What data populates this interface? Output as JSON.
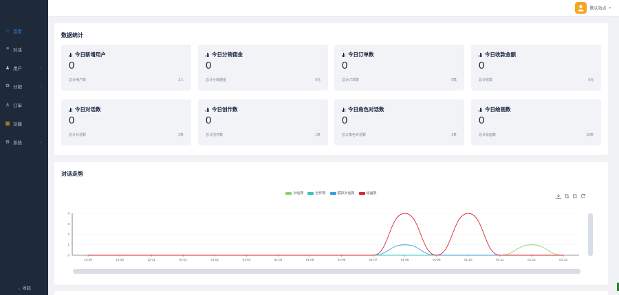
{
  "sidebar": {
    "items": [
      {
        "label": "首页",
        "icon": "home-icon",
        "active": true,
        "expandable": false
      },
      {
        "label": "对话",
        "icon": "menu-icon",
        "active": false,
        "expandable": false
      },
      {
        "label": "用户",
        "icon": "user-icon",
        "active": false,
        "expandable": true
      },
      {
        "label": "分销",
        "icon": "share-icon",
        "active": false,
        "expandable": true
      },
      {
        "label": "订单",
        "icon": "order-icon",
        "active": false,
        "expandable": false
      },
      {
        "label": "功能",
        "icon": "apps-icon",
        "active": false,
        "expandable": false
      },
      {
        "label": "系统",
        "icon": "gear-icon",
        "active": false,
        "expandable": true
      }
    ],
    "collapse_label": "← 收起"
  },
  "header": {
    "user_name": "默认站点",
    "caret": "▾"
  },
  "stats": {
    "title": "数据统计",
    "cards": [
      {
        "title": "今日新增用户",
        "value": "0",
        "foot_label": "总计用户数",
        "foot_value": "2人"
      },
      {
        "title": "今日分销佣金",
        "value": "0",
        "foot_label": "总计分销佣金",
        "foot_value": "0元"
      },
      {
        "title": "今日订单数",
        "value": "0",
        "foot_label": "总计订单数",
        "foot_value": "0笔"
      },
      {
        "title": "今日收款金额",
        "value": "0",
        "foot_label": "总计收款",
        "foot_value": "0元"
      },
      {
        "title": "今日对话数",
        "value": "0",
        "foot_label": "总计对话数",
        "foot_value": "2条"
      },
      {
        "title": "今日创作数",
        "value": "0",
        "foot_label": "总计创作数",
        "foot_value": "1条"
      },
      {
        "title": "今日角色对话数",
        "value": "0",
        "foot_label": "总计角色对话数",
        "foot_value": "1条"
      },
      {
        "title": "今日绘画数",
        "value": "0",
        "foot_label": "总计绘画数",
        "foot_value": "10条"
      }
    ]
  },
  "trend": {
    "title": "对话走势",
    "toolbox": [
      "download-icon",
      "zoom-icon",
      "zoom-reset-icon",
      "refresh-icon"
    ]
  },
  "chart_data": {
    "type": "line",
    "x": [
      "12-29",
      "12-30",
      "12-31",
      "01-01",
      "01-02",
      "01-03",
      "01-04",
      "01-05",
      "01-06",
      "01-07",
      "01-08",
      "01-09",
      "01-10",
      "01-11",
      "01-12",
      "01-13"
    ],
    "ylim": [
      0,
      4
    ],
    "yticks": [
      0,
      1,
      2,
      3,
      4
    ],
    "smooth": true,
    "legend_position": "top-center",
    "series": [
      {
        "name": "对话数",
        "color": "#91cc75",
        "values": [
          0,
          0,
          0,
          0,
          0,
          0,
          0,
          0,
          0,
          0,
          0,
          0,
          0,
          0,
          1,
          0
        ]
      },
      {
        "name": "创作数",
        "color": "#3bc4b4",
        "values": [
          0,
          0,
          0,
          0,
          0,
          0,
          0,
          0,
          0,
          0,
          0,
          0,
          0,
          0,
          0,
          0
        ]
      },
      {
        "name": "模拟对话数",
        "color": "#3a9bdc",
        "values": [
          0,
          0,
          0,
          0,
          0,
          0,
          0,
          0,
          0,
          0,
          1,
          0,
          0,
          0,
          0,
          0
        ]
      },
      {
        "name": "绘画数",
        "color": "#d9262e",
        "values": [
          0,
          0,
          0,
          0,
          0,
          0,
          0,
          0,
          0,
          0,
          4,
          0,
          4,
          0,
          0,
          0
        ]
      }
    ]
  }
}
